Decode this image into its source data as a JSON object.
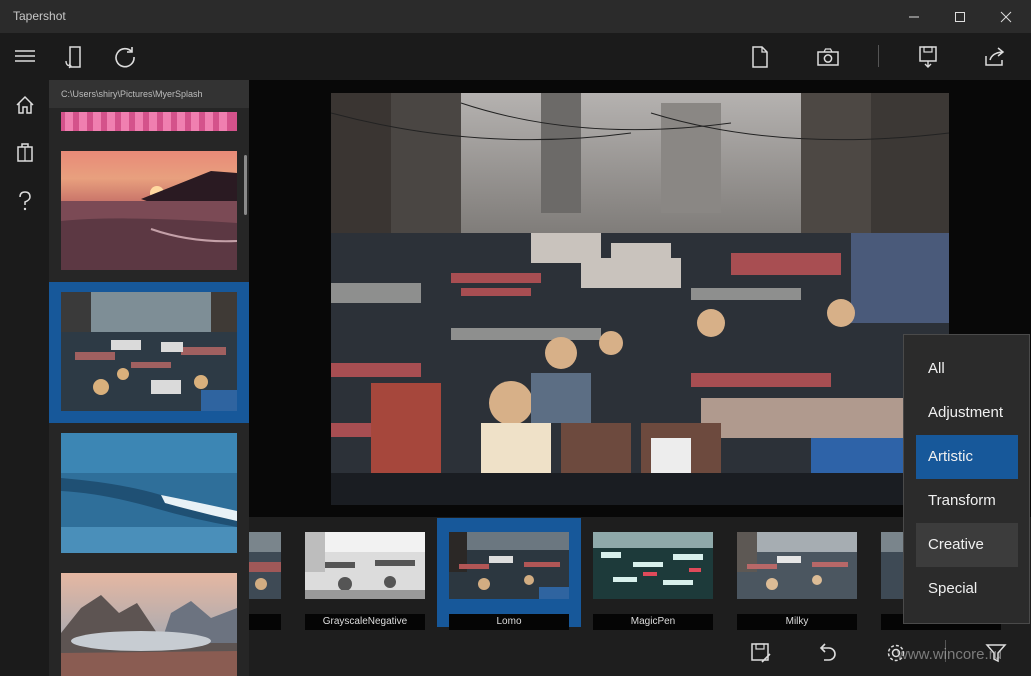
{
  "app": {
    "title": "Tapershot"
  },
  "window_controls": [
    "minimize-icon",
    "maximize-icon",
    "close-icon"
  ],
  "nav": {
    "items": [
      "hamburger-icon",
      "home-icon",
      "store-icon",
      "help-icon"
    ]
  },
  "toolbar": {
    "left": [
      "rotate-device-icon",
      "refresh-icon"
    ],
    "right": [
      "file-open-icon",
      "camera-icon",
      "save-icon",
      "share-icon"
    ]
  },
  "sidebar": {
    "path": "C:\\Users\\shiry\\Pictures\\MyerSplash",
    "thumbnails": [
      "pink-stripes",
      "sunset-sea",
      "crowded-street",
      "ocean-wave",
      "mountain-clouds"
    ],
    "selected_index": 2
  },
  "filters": {
    "items": [
      {
        "label": ""
      },
      {
        "label": "GrayscaleNegative"
      },
      {
        "label": "Lomo"
      },
      {
        "label": "MagicPen"
      },
      {
        "label": "Milky"
      },
      {
        "label": ""
      }
    ],
    "selected": "Lomo"
  },
  "bottombar": {
    "buttons": [
      "save-icon",
      "undo-icon",
      "settings-icon",
      "filter-icon"
    ]
  },
  "watermark": "www.wincore.ru",
  "filter_menu": {
    "items": [
      "All",
      "Adjustment",
      "Artistic",
      "Transform",
      "Creative",
      "Special"
    ],
    "active": "Artistic",
    "hovered": "Creative"
  },
  "colors": {
    "accent": "#17589a",
    "background": "#1f1f1f",
    "panel": "#262626"
  }
}
